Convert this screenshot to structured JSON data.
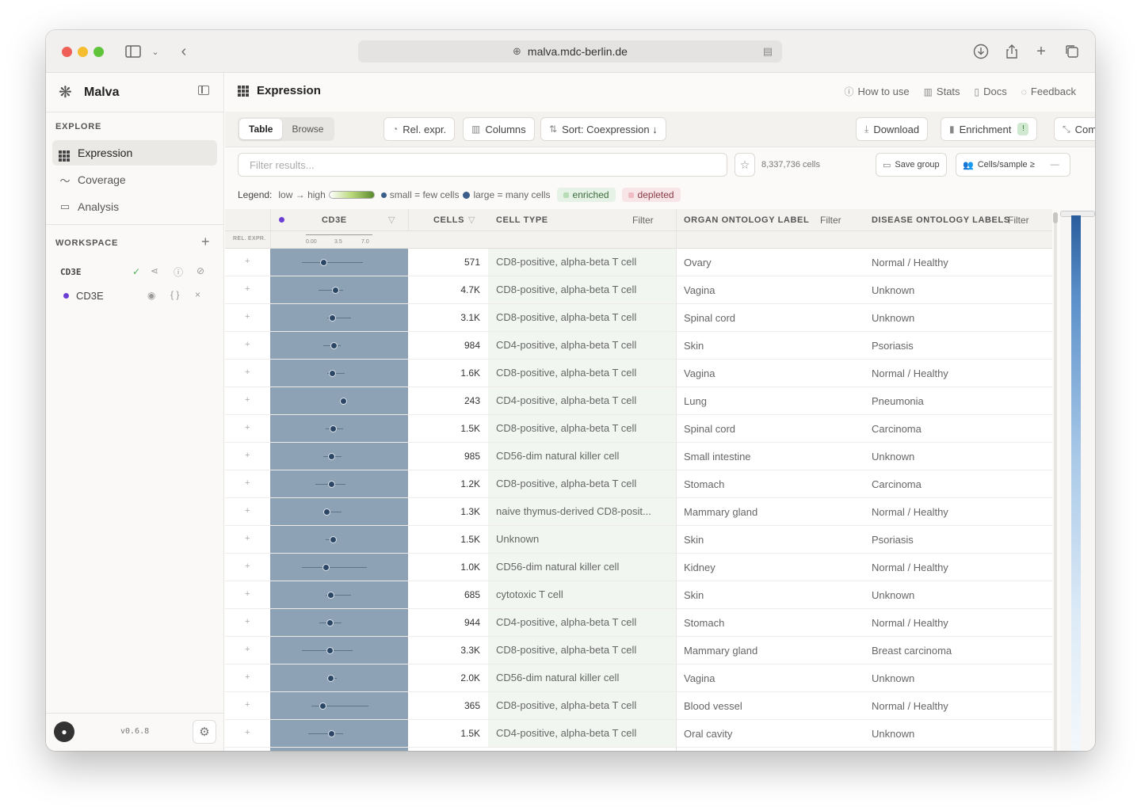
{
  "browser": {
    "url": "malva.mdc-berlin.de"
  },
  "sidebar": {
    "brand": "Malva",
    "explore_label": "EXPLORE",
    "nav": [
      {
        "label": "Expression",
        "icon": "grid-icon",
        "active": true
      },
      {
        "label": "Coverage",
        "icon": "activity-icon",
        "active": false
      },
      {
        "label": "Analysis",
        "icon": "folder-icon",
        "active": false
      }
    ],
    "workspace_label": "WORKSPACE",
    "workspace_group": "CD3E",
    "workspace_gene": "CD3E",
    "version": "v0.6.8"
  },
  "header": {
    "title": "Expression",
    "links": [
      "How to use",
      "Stats",
      "Docs",
      "Feedback"
    ]
  },
  "toolbar": {
    "view_table": "Table",
    "view_browse": "Browse",
    "rel_expr": "Rel. expr.",
    "columns": "Columns",
    "sort": "Sort: Coexpression ↓",
    "download": "Download",
    "enrichment": "Enrichment",
    "enrichment_badge": "!",
    "compact": "Compact"
  },
  "filters": {
    "search_placeholder": "Filter results...",
    "cell_count": "8,337,736 cells",
    "save_group": "Save group",
    "cells_per_sample": "Cells/sample ≥",
    "cells_per_sample_value": "—"
  },
  "legend": {
    "label": "Legend:",
    "gradient": "low → high",
    "size": "small = few cells",
    "size_large": "large = many cells",
    "enriched": "enriched",
    "depleted": "depleted"
  },
  "table": {
    "headers": {
      "gene": "CD3E",
      "cells": "CELLS",
      "cell_type": "CELL TYPE",
      "organ": "ORGAN ONTOLOGY LABEL",
      "disease": "DISEASE ONTOLOGY LABELS",
      "filter": "Filter",
      "rel_expr": "REL. EXPR."
    },
    "axis_ticks": [
      "0.00",
      "3.5",
      "7.0"
    ],
    "gene_color": "#6b3fd1",
    "rows": [
      {
        "cells": "571",
        "cell_type": "CD8-positive, alpha-beta T cell",
        "organ": "Ovary",
        "disease": "Normal / Healthy",
        "val": 0.33,
        "lo": 0.0,
        "hi": 0.92
      },
      {
        "cells": "4.7K",
        "cell_type": "CD8-positive, alpha-beta T cell",
        "organ": "Vagina",
        "disease": "Unknown",
        "val": 0.5,
        "lo": 0.25,
        "hi": 0.62
      },
      {
        "cells": "3.1K",
        "cell_type": "CD8-positive, alpha-beta T cell",
        "organ": "Spinal cord",
        "disease": "Unknown",
        "val": 0.46,
        "lo": 0.38,
        "hi": 0.74
      },
      {
        "cells": "984",
        "cell_type": "CD4-positive, alpha-beta T cell",
        "organ": "Skin",
        "disease": "Psoriasis",
        "val": 0.48,
        "lo": 0.32,
        "hi": 0.58
      },
      {
        "cells": "1.6K",
        "cell_type": "CD8-positive, alpha-beta T cell",
        "organ": "Vagina",
        "disease": "Normal / Healthy",
        "val": 0.46,
        "lo": 0.38,
        "hi": 0.64
      },
      {
        "cells": "243",
        "cell_type": "CD4-positive, alpha-beta T cell",
        "organ": "Lung",
        "disease": "Pneumonia",
        "val": 0.62,
        "lo": 0.58,
        "hi": 0.66
      },
      {
        "cells": "1.5K",
        "cell_type": "CD8-positive, alpha-beta T cell",
        "organ": "Spinal cord",
        "disease": "Carcinoma",
        "val": 0.47,
        "lo": 0.36,
        "hi": 0.62
      },
      {
        "cells": "985",
        "cell_type": "CD56-dim natural killer cell",
        "organ": "Small intestine",
        "disease": "Unknown",
        "val": 0.45,
        "lo": 0.32,
        "hi": 0.6
      },
      {
        "cells": "1.2K",
        "cell_type": "CD8-positive, alpha-beta T cell",
        "organ": "Stomach",
        "disease": "Carcinoma",
        "val": 0.45,
        "lo": 0.2,
        "hi": 0.66
      },
      {
        "cells": "1.3K",
        "cell_type": "naive thymus-derived CD8-posit...",
        "organ": "Mammary gland",
        "disease": "Normal / Healthy",
        "val": 0.38,
        "lo": 0.34,
        "hi": 0.6
      },
      {
        "cells": "1.5K",
        "cell_type": "Unknown",
        "organ": "Skin",
        "disease": "Psoriasis",
        "val": 0.47,
        "lo": 0.36,
        "hi": 0.52
      },
      {
        "cells": "1.0K",
        "cell_type": "CD56-dim natural killer cell",
        "organ": "Kidney",
        "disease": "Normal / Healthy",
        "val": 0.36,
        "lo": 0.0,
        "hi": 0.98
      },
      {
        "cells": "685",
        "cell_type": "cytotoxic T cell",
        "organ": "Skin",
        "disease": "Unknown",
        "val": 0.44,
        "lo": 0.36,
        "hi": 0.74
      },
      {
        "cells": "944",
        "cell_type": "CD4-positive, alpha-beta T cell",
        "organ": "Stomach",
        "disease": "Normal / Healthy",
        "val": 0.42,
        "lo": 0.26,
        "hi": 0.6
      },
      {
        "cells": "3.3K",
        "cell_type": "CD8-positive, alpha-beta T cell",
        "organ": "Mammary gland",
        "disease": "Breast carcinoma",
        "val": 0.42,
        "lo": 0.0,
        "hi": 0.76
      },
      {
        "cells": "2.0K",
        "cell_type": "CD56-dim natural killer cell",
        "organ": "Vagina",
        "disease": "Unknown",
        "val": 0.44,
        "lo": 0.4,
        "hi": 0.52
      },
      {
        "cells": "365",
        "cell_type": "CD8-positive, alpha-beta T cell",
        "organ": "Blood vessel",
        "disease": "Normal / Healthy",
        "val": 0.31,
        "lo": 0.14,
        "hi": 1.0
      },
      {
        "cells": "1.5K",
        "cell_type": "CD4-positive, alpha-beta T cell",
        "organ": "Oral cavity",
        "disease": "Unknown",
        "val": 0.45,
        "lo": 0.1,
        "hi": 0.62
      }
    ]
  }
}
